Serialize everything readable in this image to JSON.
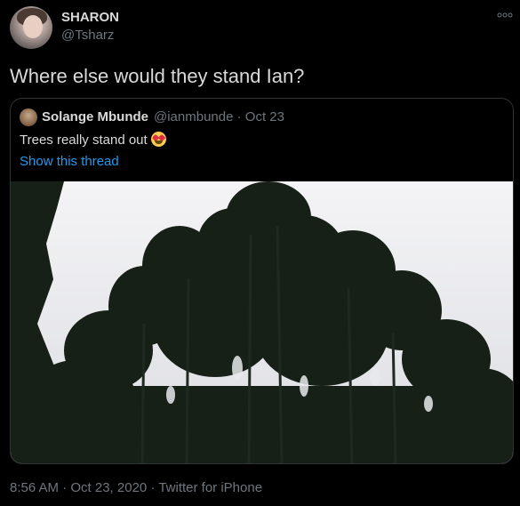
{
  "author": {
    "display_name": "SHARON",
    "handle": "@Tsharz",
    "avatar_icon": "profile-photo"
  },
  "tweet": {
    "text": "Where else would they stand Ian?",
    "more_icon": "more-dots-icon"
  },
  "quoted_tweet": {
    "display_name": "Solange Mbunde",
    "meta": "@ianmbunde · Oct 23",
    "text": "Trees really stand out",
    "emoji": "heart-eyes-emoji",
    "show_thread_label": "Show this thread",
    "image_description_icon": "trees-photo"
  },
  "footer": {
    "meta": "8:56 AM · Oct 23, 2020 · Twitter for iPhone"
  },
  "colors": {
    "background": "#000000",
    "text": "#d9d9d9",
    "secondary": "#6e767d",
    "link": "#1d9bf0",
    "border": "#2f3336"
  }
}
